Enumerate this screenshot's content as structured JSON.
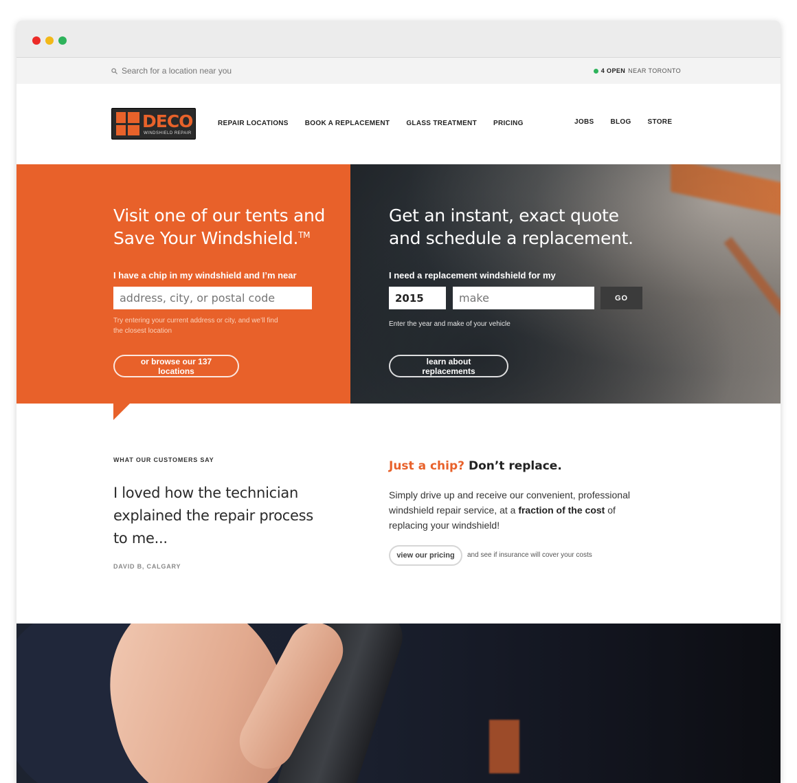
{
  "topbar": {
    "search_placeholder": "Search for a location near you",
    "open_count": "4 OPEN",
    "open_location": "NEAR TORONTO"
  },
  "logo": {
    "word": "DECO",
    "tagline": "WINDSHIELD REPAIR"
  },
  "nav": {
    "left": [
      "REPAIR LOCATIONS",
      "BOOK A REPLACEMENT",
      "GLASS TREATMENT",
      "PRICING"
    ],
    "right": [
      "JOBS",
      "BLOG",
      "STORE"
    ]
  },
  "hero_left": {
    "heading": "Visit one of our tents and Save Your Windshield.",
    "trademark": "TM",
    "label": "I have a chip in my windshield and I’m near",
    "address_placeholder": "address, city, or postal code",
    "hint": "Try entering your current address or city, and we’ll find the closest location",
    "browse_button": "or browse our 137 locations"
  },
  "hero_right": {
    "heading": "Get an instant, exact quote and schedule a replacement.",
    "label": "I need a replacement windshield for my",
    "year_value": "2015",
    "make_placeholder": "make",
    "go_button": "GO",
    "hint": "Enter the year and make of your vehicle",
    "learn_button": "learn about replacements"
  },
  "testimonial": {
    "kicker": "WHAT OUR CUSTOMERS SAY",
    "quote": "I loved how the technician explained the repair process to me...",
    "author": "DAVID B, CALGARY"
  },
  "chip": {
    "title_accent": "Just a chip?",
    "title_rest": "Don’t replace.",
    "body_1": "Simply drive up and receive our convenient, professional windshield repair service, at a",
    "body_bold": "fraction of the cost",
    "body_2": "of replacing your windshield!",
    "pricing_button": "view our pricing",
    "pricing_note": "and see if insurance will cover your costs"
  },
  "colors": {
    "accent": "#e8612a",
    "dark": "#2a2a2a",
    "open_dot": "#2eb35b"
  }
}
